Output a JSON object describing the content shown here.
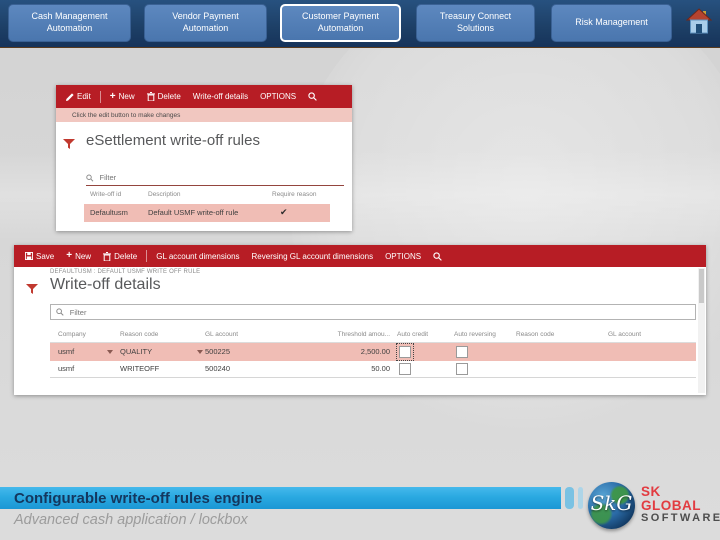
{
  "top_nav": {
    "tabs": [
      {
        "label": "Cash Management Automation",
        "selected": false
      },
      {
        "label": "Vendor Payment Automation",
        "selected": false
      },
      {
        "label": "Customer Payment Automation",
        "selected": true
      },
      {
        "label": "Treasury Connect Solutions",
        "selected": false
      },
      {
        "label": "Risk Management",
        "selected": false
      }
    ]
  },
  "icons": {
    "plus": "+",
    "check": "✔"
  },
  "inset1": {
    "toolbar": {
      "edit": "Edit",
      "new": "New",
      "delete": "Delete",
      "write_off_details": "Write-off details",
      "options": "OPTIONS"
    },
    "message": "Click the edit button to make changes",
    "title": "eSettlement write-off rules",
    "filter_placeholder": "Filter",
    "table": {
      "headers": [
        "Write-off id",
        "Description",
        "Require reason"
      ],
      "rows": [
        {
          "write_off_id": "Defaultusm",
          "description": "Default USMF write-off rule",
          "require_reason": "✔"
        }
      ]
    }
  },
  "inset2": {
    "toolbar": {
      "save": "Save",
      "new": "New",
      "delete": "Delete",
      "gl_account_dimensions": "GL account dimensions",
      "reversing_gl_account_dimensions": "Reversing GL account dimensions",
      "options": "OPTIONS"
    },
    "breadcrumb": "DEFAULTUSM : DEFAULT USMF WRITE OFF RULE",
    "title": "Write-off details",
    "filter_placeholder": "Filter",
    "table": {
      "headers": [
        "Company",
        "Reason code",
        "GL account",
        "Threshold amou...",
        "Auto credit",
        "Auto reversing",
        "Reason code",
        "GL account"
      ],
      "rows": [
        {
          "company": "usmf",
          "reason_code": "QUALITY",
          "gl_account": "500225",
          "threshold_amount": "2,500.00",
          "auto_credit": false,
          "auto_reversing": false
        },
        {
          "company": "usmf",
          "reason_code": "WRITEOFF",
          "gl_account": "500240",
          "threshold_amount": "50.00",
          "auto_credit": false,
          "auto_reversing": false
        }
      ]
    }
  },
  "footer": {
    "headline": "Configurable write-off rules engine",
    "subline": "Advanced cash application / lockbox"
  },
  "logo": {
    "monogram": "SkG",
    "name_top": "SK GLOBAL",
    "name_bottom": "SOFTWARE"
  },
  "colors": {
    "nav_band": "#1d3f66",
    "tab_fill": "#4a76ae",
    "ribbon_red": "#b71d25",
    "message_bar": "#f1c7c0",
    "row_highlight": "#f0bdb5",
    "footer_bar_blue": "#2aa9e1",
    "headline_text": "#14375e",
    "logo_red": "#e23b41"
  }
}
